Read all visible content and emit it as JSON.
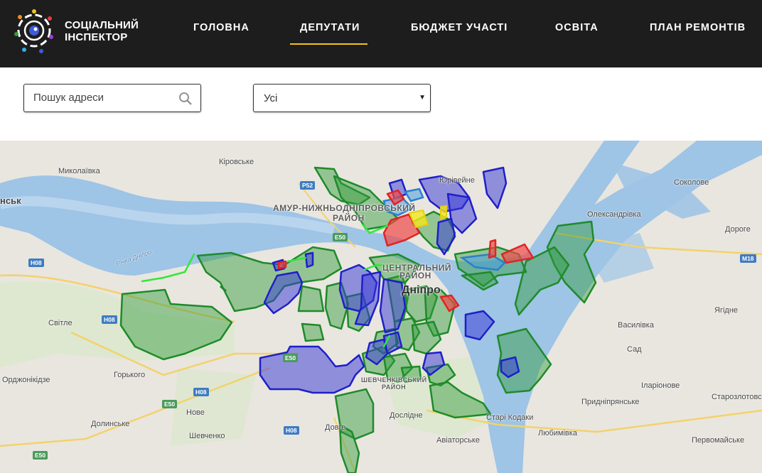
{
  "brand": {
    "line1": "СОЦІАЛЬНИЙ",
    "line2": "ІНСПЕКТОР",
    "logo_icon": "eye-circle-icon"
  },
  "nav": [
    {
      "label": "ГОЛОВНА",
      "active": false
    },
    {
      "label": "ДЕПУТАТИ",
      "active": true
    },
    {
      "label": "БЮДЖЕТ УЧАСТІ",
      "active": false
    },
    {
      "label": "ОСВІТА",
      "active": false
    },
    {
      "label": "ПЛАН РЕМОНТІВ",
      "active": false
    }
  ],
  "accent_color": "#f2c31c",
  "search": {
    "placeholder": "Пошук адреси",
    "value": "",
    "icon": "search-icon"
  },
  "filter": {
    "selected": "Усі"
  },
  "map": {
    "places": {
      "kirovske": "Кіровське",
      "mykolaivka": "Миколаївка",
      "insk": "нськ",
      "amur": "АМУР-НИЖНЬОДНІПРОВСЬКИЙ",
      "raion": "РАЙОН",
      "yuriivka": "Юрівейне",
      "sokolove": "Соколове",
      "oleksandrivka": "Олександрівка",
      "dorohe": "Дороге",
      "rika": "Річка Дніпро",
      "svitle": "Світле",
      "tsentralnyi": "ЦЕНТРАЛЬНИЙ",
      "raion2": "РАЙОН",
      "dnipro": "Дніпро",
      "yahidne": "Ягідне",
      "vasylivka": "Василівка",
      "sad": "Сад",
      "horkoho": "Горького",
      "ordzhonikidze": "Орджонікідзе",
      "iarionove": "Іларіонове",
      "shevchenkivskyi": "ШЕВЧЕНКІВСЬКИЙ",
      "raion3": "РАЙОН",
      "novе": "Нове",
      "dolynske": "Долинське",
      "doslidne": "Дослідне",
      "prydniprianske": "Придніпрянське",
      "starozlotovske": "Старозлотовське",
      "stari_kodaky": "Старі Кодаки",
      "shevchenko": "Шевченко",
      "dovhe": "Довге",
      "aviatorske": "Авіаторське",
      "liubymivka": "Любимівка",
      "pervomaiske": "Первомайське"
    },
    "roads": [
      "P52",
      "E50",
      "H08",
      "H08",
      "E50",
      "M18",
      "H08",
      "E50",
      "H08",
      "E50"
    ],
    "colors": {
      "green": "#2e9b3a",
      "blue": "#2f2fd8",
      "red": "#e53b3b",
      "yellow": "#f2e81c",
      "water": "#9ec4e6",
      "land": "#e9e6df"
    }
  }
}
